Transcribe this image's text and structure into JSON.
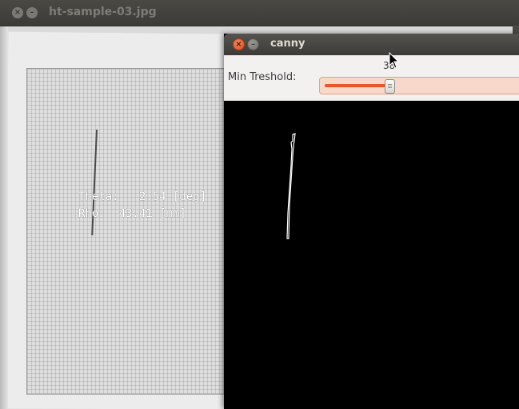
{
  "back_window": {
    "title": "ht-sample-03.jpg",
    "close_glyph": "×",
    "minimize_glyph": "–",
    "overlay": {
      "theta_line": "Theta:   2.54 [deg]",
      "rho_line": "Rho:  43.41 [mm]"
    }
  },
  "front_window": {
    "title": "canny",
    "close_glyph": "×",
    "minimize_glyph": "–",
    "trackbar": {
      "label": "Min Treshold:",
      "value": "38",
      "fill_fraction": 0.33
    }
  },
  "icons": {
    "close": "close-icon",
    "minimize": "minimize-icon",
    "cursor": "mouse-pointer-icon"
  },
  "colors": {
    "close_button_active": "#de4b1c",
    "slider_accent": "#e8572a",
    "titlebar": "#3c3b37",
    "canvas": "#000000"
  }
}
